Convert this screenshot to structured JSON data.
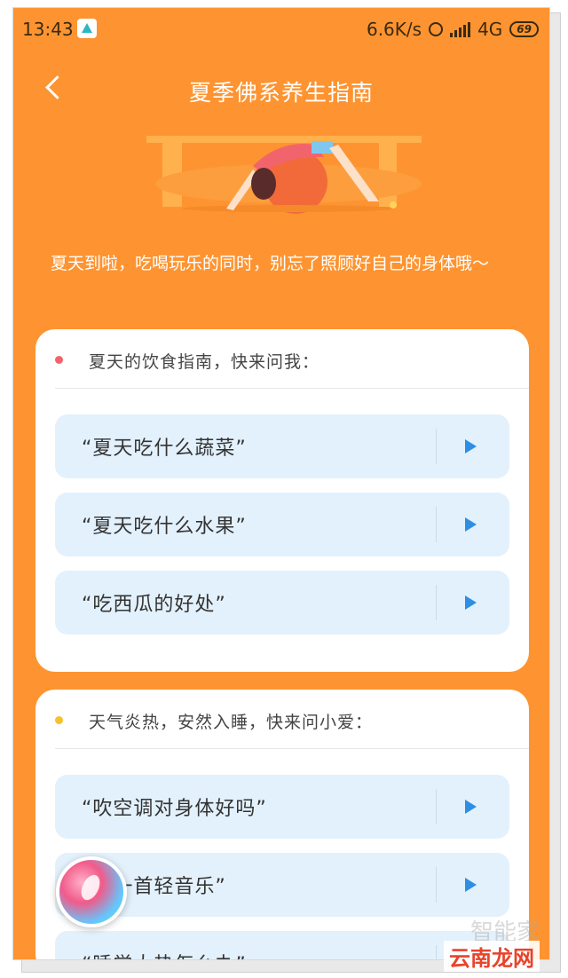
{
  "status_bar": {
    "time": "13:43",
    "net_speed": "6.6K/s",
    "network": "4G",
    "battery": "69"
  },
  "header": {
    "title": "夏季佛系养生指南"
  },
  "intro": "夏天到啦，吃喝玩乐的同时，别忘了照顾好自己的身体哦～",
  "sections": [
    {
      "title": "夏天的饮食指南，快来问我：",
      "dot_color": "#f2646b",
      "items": [
        {
          "label": "“夏天吃什么蔬菜”"
        },
        {
          "label": "“夏天吃什么水果”"
        },
        {
          "label": "“吃西瓜的好处”"
        }
      ]
    },
    {
      "title": "天气炎热，安然入睡，快来问小爱：",
      "dot_color": "#f6c12a",
      "items": [
        {
          "label": "“吹空调对身体好吗”"
        },
        {
          "label": "“放一首轻音乐”"
        },
        {
          "label": "“睡觉太热怎么办”"
        }
      ]
    }
  ],
  "watermark": {
    "faint": "智能家",
    "site": "云南龙网"
  },
  "colors": {
    "background": "#fd9431",
    "item_bg": "#e3f1fc",
    "play": "#2d8fe4"
  }
}
